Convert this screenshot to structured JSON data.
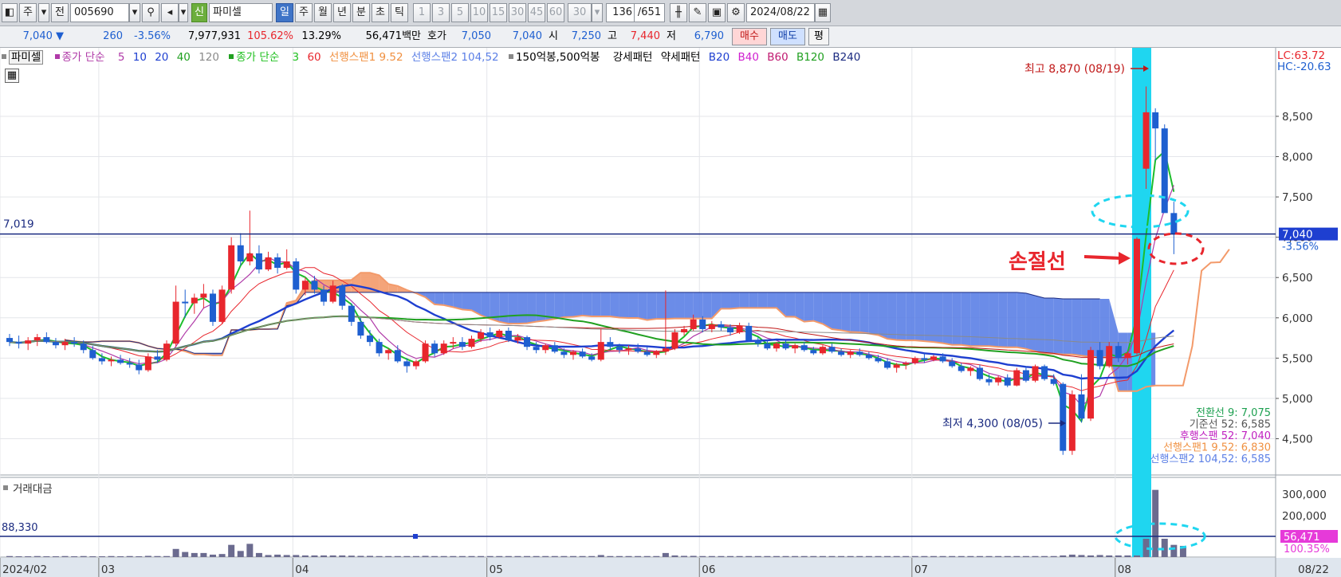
{
  "toolbar": {
    "market": "주",
    "prev": "전",
    "code": "005690",
    "name_badge": "신",
    "name": "파미셀",
    "periods": [
      "일",
      "주",
      "월",
      "년",
      "분",
      "초",
      "틱"
    ],
    "minutes": [
      "1",
      "3",
      "5",
      "10",
      "15",
      "30",
      "45",
      "60"
    ],
    "interval": "30",
    "count": "136",
    "total": "/651",
    "date": "2024/08/22"
  },
  "quote": {
    "price": "7,040",
    "change": "260",
    "change_pct": "-3.56%",
    "volume": "7,977,931",
    "vol_ratio": "105.62%",
    "turnover": "13.29%",
    "amount": "56,471백만",
    "bid_label": "호가",
    "bid": "7,050",
    "ask": "7,040",
    "open_label": "시",
    "open": "7,250",
    "high_label": "고",
    "high": "7,440",
    "low_label": "저",
    "low": "6,790",
    "buy": "매수",
    "sell": "매도",
    "avg": "평"
  },
  "legend": {
    "name": "파미셀",
    "ma_label": "종가 단순",
    "ma_periods": [
      "5",
      "10",
      "20",
      "40",
      "120"
    ],
    "ma2_label": "종가 단순",
    "ma2_periods": [
      "3",
      "60"
    ],
    "span1": "선행스팬1 9.52",
    "span2": "선행스팬2 104,52",
    "extra1": "150억봉,500억봉",
    "extra2": "강세패턴",
    "extra3": "약세패턴",
    "bands": [
      "B20",
      "B40",
      "B60",
      "B120",
      "B240"
    ]
  },
  "colors": {
    "up": "#e8262d",
    "down": "#1e5fd0",
    "cloud": "#5b7fe6",
    "cloud_red": "#f39a6a",
    "highlight": "#1fd6f0",
    "ma5": "#1dbd2b",
    "ma10": "#e8262d",
    "ma20": "#1e3fd0",
    "ma40": "#20a020",
    "ma120": "#8a8a8a"
  },
  "chart_data": {
    "type": "candlestick",
    "x_ticks": [
      "2024/02",
      "03",
      "04",
      "05",
      "06",
      "07",
      "08",
      "08/22"
    ],
    "y_ticks": [
      8500,
      8000,
      7500,
      7000,
      6500,
      6000,
      5500,
      5000,
      4500
    ],
    "ylim": [
      4050,
      9350
    ],
    "annotations": {
      "high": "최고 8,870 (08/19)",
      "low": "최저 4,300 (08/05)",
      "stoploss": "손절선",
      "lc": "LC:63.72",
      "hc": "HC:-20.63",
      "level_left": "7,019",
      "price_tag": "7,040",
      "price_pct": "-3.56%"
    },
    "ichimoku": [
      "전환선 9: 7,075",
      "기준선 52: 6,585",
      "후행스팬 52: 7,040",
      "선행스팬1 9.52: 6,830",
      "선행스팬2 104,52: 6,585"
    ],
    "series": [
      {
        "name": "candles",
        "ohlc": [
          [
            5750,
            5800,
            5650,
            5700
          ],
          [
            5700,
            5780,
            5620,
            5680
          ],
          [
            5680,
            5760,
            5600,
            5720
          ],
          [
            5720,
            5800,
            5650,
            5760
          ],
          [
            5760,
            5820,
            5680,
            5700
          ],
          [
            5700,
            5750,
            5620,
            5660
          ],
          [
            5660,
            5740,
            5600,
            5700
          ],
          [
            5700,
            5760,
            5640,
            5680
          ],
          [
            5680,
            5720,
            5560,
            5600
          ],
          [
            5600,
            5650,
            5480,
            5500
          ],
          [
            5500,
            5560,
            5420,
            5460
          ],
          [
            5460,
            5520,
            5400,
            5480
          ],
          [
            5480,
            5540,
            5420,
            5440
          ],
          [
            5440,
            5500,
            5380,
            5420
          ],
          [
            5420,
            5480,
            5300,
            5350
          ],
          [
            5350,
            5560,
            5330,
            5520
          ],
          [
            5520,
            5600,
            5440,
            5480
          ],
          [
            5480,
            5720,
            5460,
            5680
          ],
          [
            5680,
            6400,
            5640,
            6200
          ],
          [
            6200,
            6350,
            6000,
            6180
          ],
          [
            6180,
            6300,
            6050,
            6250
          ],
          [
            6250,
            6420,
            6120,
            6300
          ],
          [
            6300,
            6350,
            5900,
            5950
          ],
          [
            5950,
            6400,
            5920,
            6350
          ],
          [
            6350,
            7000,
            6300,
            6900
          ],
          [
            6900,
            7050,
            6650,
            6700
          ],
          [
            6700,
            7330,
            6650,
            6800
          ],
          [
            6800,
            6900,
            6550,
            6600
          ],
          [
            6600,
            6820,
            6580,
            6750
          ],
          [
            6750,
            6800,
            6550,
            6620
          ],
          [
            6620,
            6850,
            6600,
            6700
          ],
          [
            6700,
            6740,
            6300,
            6350
          ],
          [
            6350,
            6500,
            6280,
            6460
          ],
          [
            6460,
            6520,
            6300,
            6350
          ],
          [
            6350,
            6400,
            6150,
            6200
          ],
          [
            6200,
            6460,
            6180,
            6400
          ],
          [
            6400,
            6420,
            6100,
            6150
          ],
          [
            6150,
            6180,
            5900,
            5950
          ],
          [
            5950,
            6000,
            5740,
            5780
          ],
          [
            5780,
            5850,
            5650,
            5700
          ],
          [
            5700,
            5740,
            5520,
            5560
          ],
          [
            5560,
            5620,
            5480,
            5600
          ],
          [
            5600,
            5660,
            5440,
            5460
          ],
          [
            5460,
            5500,
            5320,
            5400
          ],
          [
            5400,
            5480,
            5360,
            5460
          ],
          [
            5460,
            5720,
            5440,
            5680
          ],
          [
            5680,
            5720,
            5520,
            5560
          ],
          [
            5560,
            5720,
            5540,
            5680
          ],
          [
            5680,
            5760,
            5620,
            5700
          ],
          [
            5700,
            5760,
            5600,
            5640
          ],
          [
            5640,
            5780,
            5620,
            5740
          ],
          [
            5740,
            5860,
            5700,
            5820
          ],
          [
            5820,
            5880,
            5720,
            5760
          ],
          [
            5760,
            5860,
            5740,
            5840
          ],
          [
            5840,
            5880,
            5700,
            5720
          ],
          [
            5720,
            5800,
            5680,
            5760
          ],
          [
            5760,
            5780,
            5600,
            5640
          ],
          [
            5640,
            5700,
            5560,
            5600
          ],
          [
            5600,
            5680,
            5560,
            5660
          ],
          [
            5660,
            5700,
            5560,
            5580
          ],
          [
            5580,
            5620,
            5500,
            5540
          ],
          [
            5540,
            5600,
            5480,
            5580
          ],
          [
            5580,
            5620,
            5500,
            5520
          ],
          [
            5520,
            5560,
            5460,
            5480
          ],
          [
            5480,
            5860,
            5460,
            5700
          ],
          [
            5700,
            5760,
            5600,
            5640
          ],
          [
            5640,
            5680,
            5560,
            5600
          ],
          [
            5600,
            5660,
            5540,
            5620
          ],
          [
            5620,
            5680,
            5560,
            5580
          ],
          [
            5580,
            5640,
            5520,
            5540
          ],
          [
            5540,
            5600,
            5500,
            5580
          ],
          [
            5580,
            6340,
            5540,
            5620
          ],
          [
            5620,
            5860,
            5600,
            5820
          ],
          [
            5820,
            5900,
            5780,
            5860
          ],
          [
            5860,
            6040,
            5840,
            5980
          ],
          [
            5980,
            6020,
            5820,
            5860
          ],
          [
            5860,
            5960,
            5820,
            5920
          ],
          [
            5920,
            5960,
            5840,
            5880
          ],
          [
            5880,
            5920,
            5780,
            5820
          ],
          [
            5820,
            5940,
            5800,
            5900
          ],
          [
            5900,
            5940,
            5700,
            5720
          ],
          [
            5720,
            5760,
            5640,
            5680
          ],
          [
            5680,
            5720,
            5600,
            5620
          ],
          [
            5620,
            5700,
            5580,
            5680
          ],
          [
            5680,
            5720,
            5600,
            5620
          ],
          [
            5620,
            5680,
            5560,
            5660
          ],
          [
            5660,
            5700,
            5580,
            5600
          ],
          [
            5600,
            5640,
            5540,
            5560
          ],
          [
            5560,
            5660,
            5540,
            5640
          ],
          [
            5640,
            5680,
            5560,
            5580
          ],
          [
            5580,
            5620,
            5520,
            5540
          ],
          [
            5540,
            5600,
            5500,
            5580
          ],
          [
            5580,
            5620,
            5520,
            5540
          ],
          [
            5540,
            5580,
            5480,
            5500
          ],
          [
            5500,
            5540,
            5440,
            5460
          ],
          [
            5460,
            5500,
            5360,
            5380
          ],
          [
            5380,
            5440,
            5320,
            5420
          ],
          [
            5420,
            5460,
            5360,
            5440
          ],
          [
            5440,
            5520,
            5420,
            5500
          ],
          [
            5500,
            5560,
            5440,
            5480
          ],
          [
            5480,
            5540,
            5460,
            5520
          ],
          [
            5520,
            5560,
            5440,
            5460
          ],
          [
            5460,
            5500,
            5380,
            5400
          ],
          [
            5400,
            5440,
            5320,
            5340
          ],
          [
            5340,
            5400,
            5280,
            5380
          ],
          [
            5380,
            5420,
            5220,
            5240
          ],
          [
            5240,
            5300,
            5160,
            5200
          ],
          [
            5200,
            5280,
            5160,
            5260
          ],
          [
            5260,
            5300,
            5140,
            5160
          ],
          [
            5160,
            5380,
            5150,
            5350
          ],
          [
            5350,
            5400,
            5200,
            5220
          ],
          [
            5220,
            5420,
            5200,
            5400
          ],
          [
            5400,
            5420,
            5220,
            5240
          ],
          [
            5240,
            5300,
            5160,
            5180
          ],
          [
            5180,
            5200,
            4300,
            4350
          ],
          [
            4350,
            5100,
            4300,
            5050
          ],
          [
            5050,
            5300,
            4700,
            4750
          ],
          [
            4750,
            5640,
            4720,
            5600
          ],
          [
            5600,
            5700,
            5360,
            5400
          ],
          [
            5400,
            5700,
            5380,
            5650
          ],
          [
            5650,
            5700,
            5450,
            5500
          ],
          [
            5500,
            5580,
            5420,
            5560
          ],
          [
            5560,
            7000,
            5540,
            6980
          ],
          [
            7850,
            8870,
            7600,
            8550
          ],
          [
            8550,
            8600,
            7950,
            8350
          ],
          [
            8350,
            8400,
            7400,
            7300
          ],
          [
            7300,
            7440,
            6790,
            7040
          ]
        ]
      },
      {
        "name": "volume",
        "values": [
          5,
          4,
          4,
          5,
          4,
          4,
          5,
          4,
          5,
          4,
          4,
          5,
          4,
          5,
          4,
          6,
          5,
          5,
          40,
          25,
          20,
          20,
          12,
          15,
          60,
          30,
          65,
          20,
          10,
          12,
          10,
          10,
          8,
          8,
          8,
          8,
          8,
          7,
          6,
          6,
          5,
          5,
          5,
          5,
          5,
          6,
          5,
          5,
          5,
          5,
          5,
          5,
          5,
          5,
          5,
          5,
          5,
          5,
          5,
          5,
          5,
          5,
          5,
          5,
          10,
          5,
          5,
          5,
          5,
          5,
          5,
          20,
          8,
          6,
          6,
          5,
          5,
          5,
          5,
          5,
          5,
          5,
          5,
          5,
          5,
          5,
          5,
          5,
          5,
          5,
          5,
          5,
          5,
          5,
          5,
          5,
          5,
          5,
          5,
          5,
          5,
          5,
          5,
          5,
          5,
          5,
          5,
          5,
          5,
          5,
          5,
          5,
          5,
          5,
          8,
          12,
          10,
          8,
          10,
          8,
          8,
          8,
          8,
          90,
          330,
          90,
          60,
          55
        ]
      }
    ],
    "volume_panel": {
      "title": "거래대금",
      "y_ticks": [
        "300,000",
        "200,000"
      ],
      "level_left": "88,330",
      "value_tag": "56,471",
      "pct_tag": "100.35%"
    }
  }
}
